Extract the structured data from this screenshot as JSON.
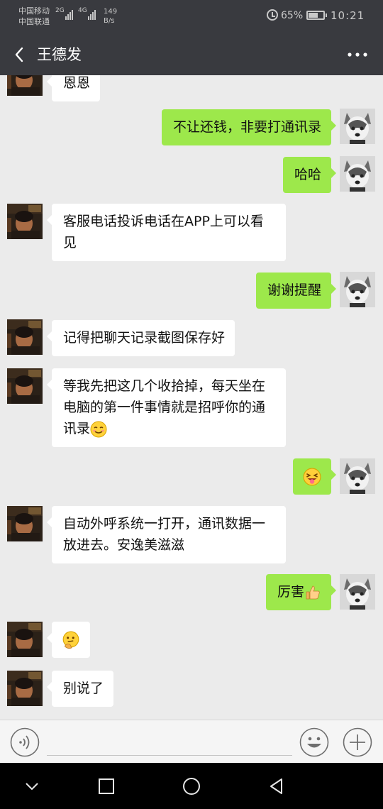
{
  "status_bar": {
    "carrier_1": "中国移动",
    "carrier_2": "中国联通",
    "signal_1_type": "2G",
    "signal_2_type": "4G",
    "net_speed_value": "149",
    "net_speed_unit": "B/s",
    "battery": "65%",
    "battery_level": 0.65,
    "time": "10:21"
  },
  "header": {
    "title": "王德发",
    "back_icon": "chevron-left-icon",
    "more_icon": "more-dots-icon"
  },
  "messages": [
    {
      "side": "left",
      "text": "恩恩"
    },
    {
      "side": "right",
      "text": "不让还钱，非要打通讯录"
    },
    {
      "side": "right",
      "text": "哈哈"
    },
    {
      "side": "left",
      "text": "客服电话投诉电话在APP上可以看见"
    },
    {
      "side": "right",
      "text": "谢谢提醒"
    },
    {
      "side": "left",
      "text": "记得把聊天记录截图保存好"
    },
    {
      "side": "left",
      "text": "等我先把这几个收拾掉，每天坐在电脑的第一件事情就是招呼你的通讯录",
      "emoji": "blushing-smile-emoji"
    },
    {
      "side": "right",
      "text": "",
      "emoji": "tongue-out-emoji"
    },
    {
      "side": "left",
      "text": "自动外呼系统一打开，通讯数据一放进去。安逸美滋滋"
    },
    {
      "side": "right",
      "text": "厉害",
      "emoji": "thumbs-up-emoji"
    },
    {
      "side": "left",
      "text": "",
      "emoji": "thinking-face-emoji"
    },
    {
      "side": "left",
      "text": "别说了"
    }
  ],
  "input_bar": {
    "voice_icon": "voice-icon",
    "emoji_icon": "smiley-icon",
    "plus_icon": "plus-icon",
    "input_value": ""
  },
  "nav_bar": {
    "icons": [
      "chevron-down-icon",
      "square-icon",
      "circle-icon",
      "triangle-back-icon"
    ]
  },
  "colors": {
    "header_bg": "#393a3f",
    "chat_bg": "#ebebeb",
    "sent_bubble": "#9de84b",
    "received_bubble": "#ffffff"
  }
}
